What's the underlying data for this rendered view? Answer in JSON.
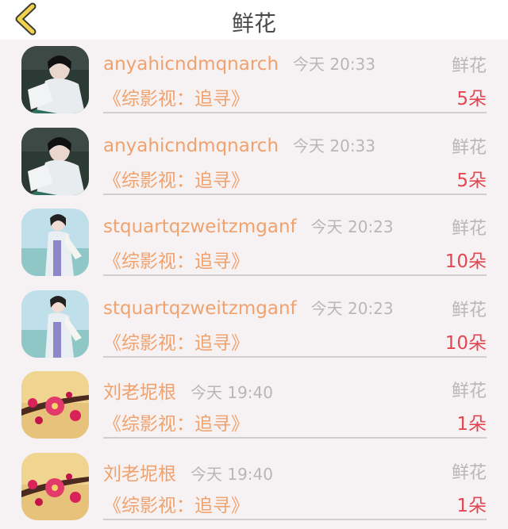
{
  "header": {
    "title": "鲜花",
    "back_icon": "chevron-left-icon"
  },
  "colors": {
    "username": "#f0a26e",
    "count": "#e34652",
    "muted": "#b7b7b7",
    "back_icon": "#f2d24a"
  },
  "rows": [
    {
      "username": "anyahicndmqnarch",
      "time": "今天 20:33",
      "gift": "鲜花",
      "book": "《综影视：追寻》",
      "count": "5朵",
      "avatar": "avatar-girl-dark"
    },
    {
      "username": "anyahicndmqnarch",
      "time": "今天 20:33",
      "gift": "鲜花",
      "book": "《综影视：追寻》",
      "count": "5朵",
      "avatar": "avatar-girl-dark"
    },
    {
      "username": "stquartqzweitzmganf",
      "time": "今天 20:23",
      "gift": "鲜花",
      "book": "《综影视：追寻》",
      "count": "10朵",
      "avatar": "avatar-girl-light"
    },
    {
      "username": "stquartqzweitzmganf",
      "time": "今天 20:23",
      "gift": "鲜花",
      "book": "《综影视：追寻》",
      "count": "10朵",
      "avatar": "avatar-girl-light"
    },
    {
      "username": "刘老坭根",
      "time": "今天 19:40",
      "gift": "鲜花",
      "book": "《综影视：追寻》",
      "count": "1朵",
      "avatar": "avatar-plum-blossom"
    },
    {
      "username": "刘老坭根",
      "time": "今天 19:40",
      "gift": "鲜花",
      "book": "《综影视：追寻》",
      "count": "1朵",
      "avatar": "avatar-plum-blossom"
    }
  ]
}
